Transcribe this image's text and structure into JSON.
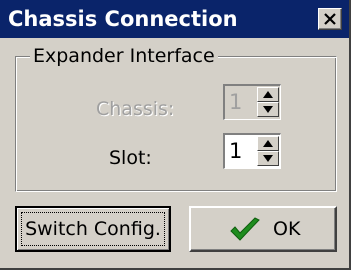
{
  "window": {
    "title": "Chassis Connection"
  },
  "group": {
    "label": "Expander Interface"
  },
  "fields": {
    "chassis": {
      "label": "Chassis:",
      "value": "1",
      "enabled": false
    },
    "slot": {
      "label": "Slot:",
      "value": "1",
      "enabled": true
    }
  },
  "buttons": {
    "switch_config": "Switch Config.",
    "ok": "OK"
  },
  "colors": {
    "titlebar": "#0a246a",
    "face": "#d4d0c8",
    "check_icon": "#1e8c1e"
  },
  "icons": {
    "close": "close-icon",
    "ok": "checkmark-icon",
    "spin_up": "arrow-up-icon",
    "spin_down": "arrow-down-icon"
  }
}
